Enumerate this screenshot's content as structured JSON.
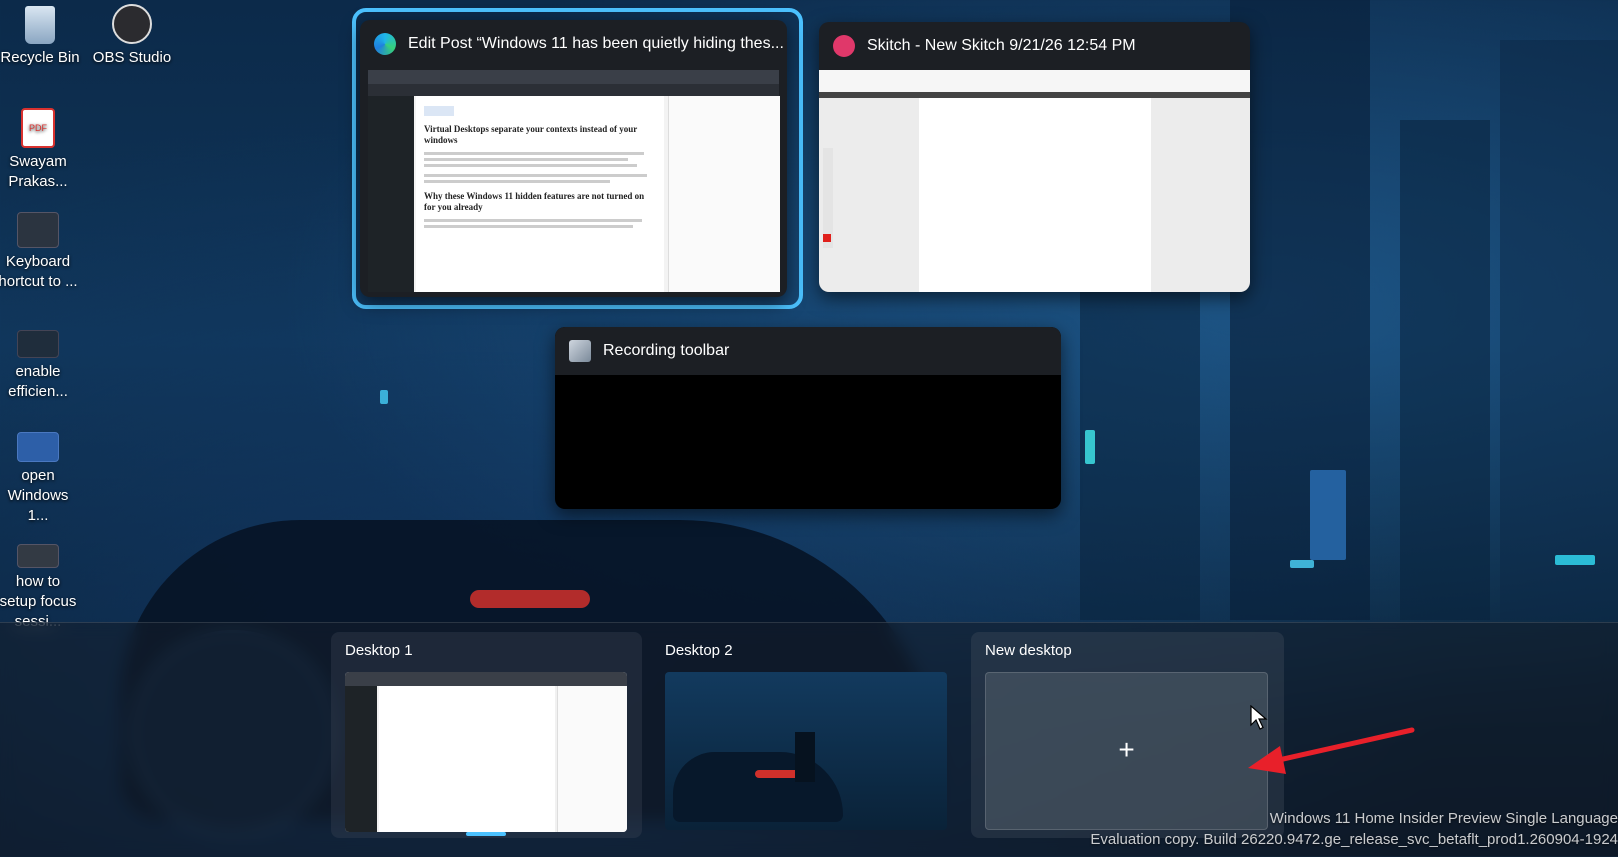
{
  "desktop": {
    "icons": [
      {
        "label": "Recycle Bin"
      },
      {
        "label": "OBS Studio"
      },
      {
        "label": "Swayam Prakas..."
      },
      {
        "label": "Keyboard hortcut to ..."
      },
      {
        "label": "enable efficien..."
      },
      {
        "label": "open Windows 1..."
      },
      {
        "label": "how to setup focus sessi..."
      }
    ]
  },
  "task_view": {
    "windows": [
      {
        "title": "Edit Post “Windows 11 has been quietly hiding thes...",
        "content_heading_1": "Virtual Desktops separate your contexts instead of your windows",
        "content_heading_2": "Why these Windows 11 hidden features are not turned on for you already"
      },
      {
        "title": "Skitch - New Skitch 9/21/26 12:54 PM"
      },
      {
        "title": "Recording toolbar"
      }
    ],
    "desktops": [
      {
        "label": "Desktop 1"
      },
      {
        "label": "Desktop 2"
      },
      {
        "label": "New desktop",
        "plus": "+"
      }
    ]
  },
  "watermark": {
    "line1": "Windows 11 Home Insider Preview Single Language",
    "line2": "Evaluation copy. Build 26220.9472.ge_release_svc_betaflt_prod1.260904-1924"
  },
  "colors": {
    "accent": "#4cc2ff",
    "annotation_arrow": "#e8202a"
  }
}
